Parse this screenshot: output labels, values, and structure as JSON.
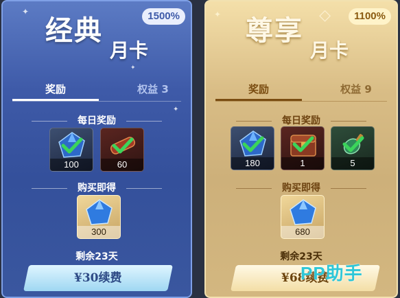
{
  "classic_card": {
    "title_main": "经典",
    "title_sub": "月卡",
    "badge": "1500%",
    "tabs": [
      {
        "label": "奖励"
      },
      {
        "label": "权益 3"
      }
    ],
    "daily_title": "每日奖励",
    "daily_items": [
      {
        "icon": "blue-diamond-icon",
        "count": "100",
        "claimed": true
      },
      {
        "icon": "red-scroll-icon",
        "count": "60",
        "claimed": true
      }
    ],
    "purchase_title": "购买即得",
    "purchase_items": [
      {
        "icon": "blue-diamond-icon",
        "count": "300"
      }
    ],
    "remaining": "剩余23天",
    "renew_label": "¥30续费",
    "accent": "#3e5aa8"
  },
  "premium_card": {
    "title_main": "尊享",
    "title_sub": "月卡",
    "badge": "1100%",
    "tabs": [
      {
        "label": "奖励"
      },
      {
        "label": "权益 9"
      }
    ],
    "daily_title": "每日奖励",
    "daily_items": [
      {
        "icon": "blue-diamond-icon",
        "count": "180",
        "claimed": true
      },
      {
        "icon": "treasure-chest-icon",
        "count": "1",
        "claimed": true
      },
      {
        "icon": "green-potion-icon",
        "count": "5",
        "claimed": true
      }
    ],
    "purchase_title": "购买即得",
    "purchase_items": [
      {
        "icon": "blue-diamond-icon",
        "count": "680"
      }
    ],
    "remaining": "剩余23天",
    "renew_label": "¥68续费",
    "accent": "#d3b780"
  },
  "watermark": "PP助手"
}
